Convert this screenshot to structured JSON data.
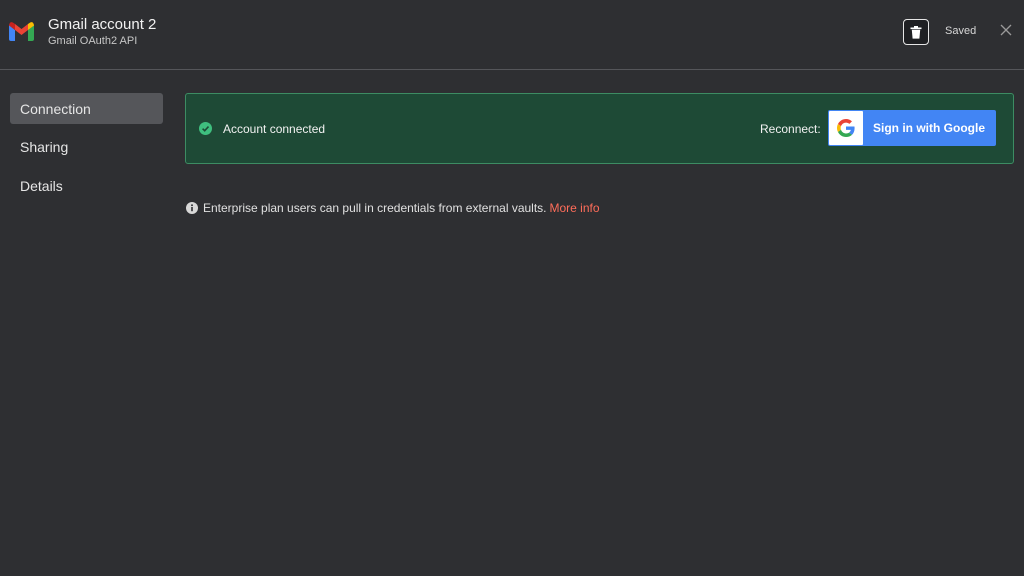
{
  "header": {
    "title": "Gmail account 2",
    "subtitle": "Gmail OAuth2 API",
    "saved_label": "Saved",
    "icons": {
      "logo": "gmail-logo",
      "delete": "trash-icon",
      "close": "close-icon"
    }
  },
  "sidebar": {
    "items": [
      {
        "label": "Connection",
        "active": true
      },
      {
        "label": "Sharing",
        "active": false
      },
      {
        "label": "Details",
        "active": false
      }
    ]
  },
  "connection": {
    "status_text": "Account connected",
    "reconnect_label": "Reconnect:",
    "signin_button_label": "Sign in with Google",
    "status_color": "#1e4a36",
    "button_color": "#4285f4"
  },
  "info": {
    "text": "Enterprise plan users can pull in credentials from external vaults.",
    "link_text": "More info",
    "link_color": "#ff6d5a"
  }
}
